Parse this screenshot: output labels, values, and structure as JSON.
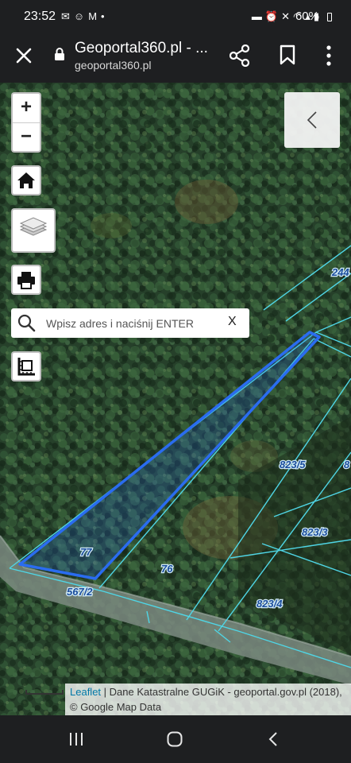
{
  "status": {
    "time": "23:52",
    "battery": "60%",
    "left_icons": [
      "✉",
      "☺",
      "M",
      "•"
    ],
    "right_icons": [
      "▬",
      "⏰",
      "✕",
      "◠",
      "▴",
      "▮"
    ]
  },
  "browser": {
    "title": "Geoportal360.pl - ...",
    "url": "geoportal360.pl"
  },
  "map": {
    "zoom_in": "+",
    "zoom_out": "−",
    "search_placeholder": "Wpisz adres i naciśnij ENTER",
    "search_clear": "X",
    "parcels": {
      "p77": "77",
      "p76": "76",
      "p567_2": "567/2",
      "p823_5": "823/5",
      "p823_3": "823/3",
      "p823_4": "823/4",
      "p244": "244",
      "p8": "8"
    },
    "attribution": {
      "leaflet": "Leaflet",
      "text": " | Dane Katastralne GUGiK - geoportal.gov.pl (2018), © Google Map Data"
    },
    "colors": {
      "selected_parcel": "#2a6cf0",
      "parcel_lines": "#4fd6e6",
      "parcel_label": "#1b4d9c"
    }
  }
}
